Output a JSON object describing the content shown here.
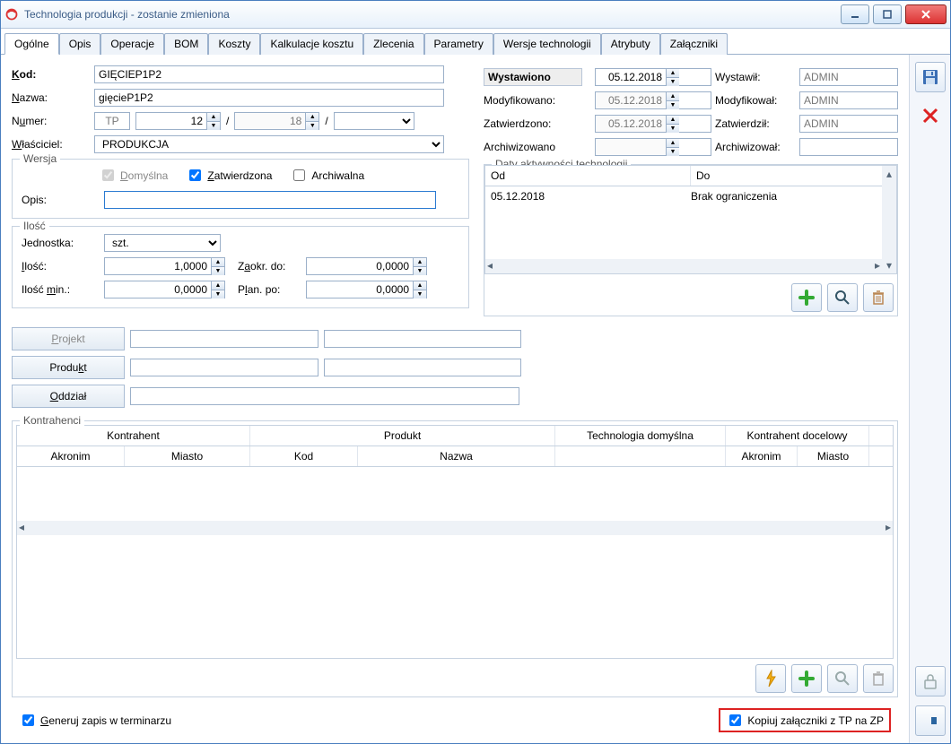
{
  "window": {
    "title": "Technologia produkcji - zostanie zmieniona"
  },
  "tabs": [
    "Ogólne",
    "Opis",
    "Operacje",
    "BOM",
    "Koszty",
    "Kalkulacje kosztu",
    "Zlecenia",
    "Parametry",
    "Wersje technologii",
    "Atrybuty",
    "Załączniki"
  ],
  "labels": {
    "kod": "Kod:",
    "nazwa": "Nazwa:",
    "numer": "Numer:",
    "wlasciciel": "Właściciel:",
    "wersja": "Wersja",
    "opis": "Opis:",
    "ilosc_grp": "Ilość",
    "jednostka": "Jednostka:",
    "ilosc": "Ilość:",
    "ilosc_min": "Ilość min.:",
    "zaokr": "Zaokr. do:",
    "plan": "Plan. po:",
    "projekt": "Projekt",
    "produkt": "Produkt",
    "oddzial": "Oddział",
    "kontrahenci": "Kontrahenci",
    "daty": "Daty aktywności technologii",
    "od": "Od",
    "do": "Do",
    "wystawiono": "Wystawiono",
    "modyfikowano": "Modyfikowano:",
    "zatwierdzono": "Zatwierdzono:",
    "archiwizowano": "Archiwizowano",
    "wystawil": "Wystawił:",
    "modyfikowal": "Modyfikował:",
    "zatwierdzil": "Zatwierdził:",
    "archiwizowal": "Archiwizował:",
    "generuj": "Generuj zapis w terminarzu",
    "kopiuj": "Kopiuj załączniki z TP na ZP",
    "domyslna": "Domyślna",
    "zatwierdzona": "Zatwierdzona",
    "archiwalna": "Archiwalna"
  },
  "values": {
    "kod": "GIĘCIEP1P2",
    "nazwa": "gięcieP1P2",
    "numer_prefix": "TP",
    "numer_a": "12",
    "numer_b": "18",
    "numer_c": "",
    "wlasciciel": "PRODUKCJA",
    "opis": "",
    "jednostka": "szt.",
    "ilosc": "1,0000",
    "ilosc_min": "0,0000",
    "zaokr": "0,0000",
    "plan": "0,0000",
    "wystawiono": "05.12.2018",
    "modyfikowano": "05.12.2018",
    "zatwierdzono": "05.12.2018",
    "archiwizowano": "",
    "wystawil": "ADMIN",
    "modyfikowal": "ADMIN",
    "zatwierdzil": "ADMIN",
    "archiwizowal": "",
    "akt_od": "05.12.2018",
    "akt_do": "Brak ograniczenia"
  },
  "kontr_headers": {
    "kontrahent": "Kontrahent",
    "produkt": "Produkt",
    "tech": "Technologia domyślna",
    "kontr_doc": "Kontrahent docelowy",
    "akronim": "Akronim",
    "miasto": "Miasto",
    "kod": "Kod",
    "nazwa": "Nazwa"
  },
  "icons": {
    "save": "save-icon",
    "delete": "delete-icon",
    "lock": "lock-icon",
    "pin": "pin-icon",
    "bolt": "bolt-icon",
    "add": "add-icon",
    "search": "search-icon",
    "trash": "trash-icon"
  }
}
